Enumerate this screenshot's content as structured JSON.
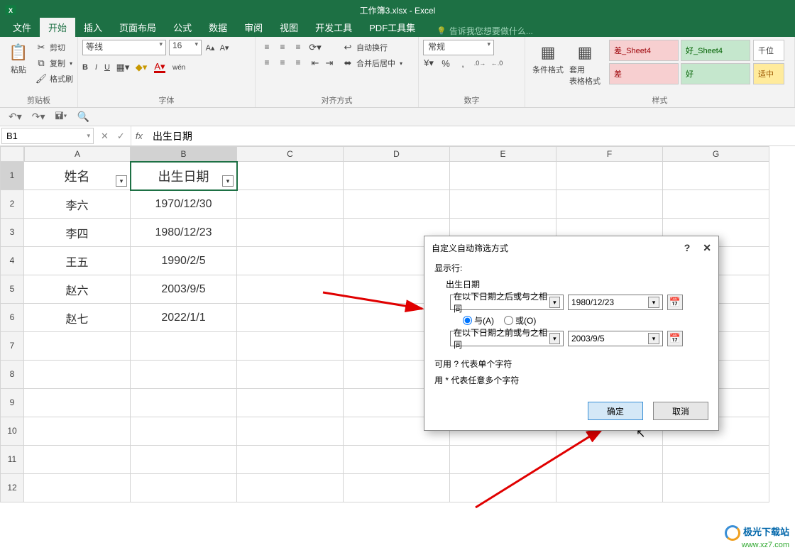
{
  "title": "工作簿3.xlsx - Excel",
  "tabs": [
    "文件",
    "开始",
    "插入",
    "页面布局",
    "公式",
    "数据",
    "审阅",
    "视图",
    "开发工具",
    "PDF工具集"
  ],
  "active_tab": "开始",
  "tell_me": "告诉我您想要做什么...",
  "ribbon": {
    "clipboard": {
      "label": "剪贴板",
      "paste": "粘贴",
      "cut": "剪切",
      "copy": "复制",
      "format_painter": "格式刷"
    },
    "font": {
      "label": "字体",
      "font_name": "等线",
      "font_size": "16",
      "bold": "B",
      "italic": "I",
      "underline": "U",
      "wen": "wén"
    },
    "alignment": {
      "label": "对齐方式",
      "wrap_text": "自动换行",
      "merge_center": "合并后居中"
    },
    "number": {
      "label": "数字",
      "format": "常规"
    },
    "styles": {
      "label": "样式",
      "conditional": "条件格式",
      "table": "套用\n表格格式",
      "cell1": "差_Sheet4",
      "cell2": "好_Sheet4",
      "cell3": "差",
      "cell4": "好",
      "cell5": "千位",
      "cell6": "适中"
    }
  },
  "name_box": "B1",
  "formula": "出生日期",
  "columns": [
    "A",
    "B",
    "C",
    "D",
    "E",
    "F",
    "G"
  ],
  "rows_count": 12,
  "table": {
    "headers": [
      "姓名",
      "出生日期"
    ],
    "data": [
      [
        "李六",
        "1970/12/30"
      ],
      [
        "李四",
        "1980/12/23"
      ],
      [
        "王五",
        "1990/2/5"
      ],
      [
        "赵六",
        "2003/9/5"
      ],
      [
        "赵七",
        "2022/1/1"
      ]
    ]
  },
  "dialog": {
    "title": "自定义自动筛选方式",
    "help": "?",
    "close": "✕",
    "show_rows": "显示行:",
    "column_name": "出生日期",
    "criteria1_op": "在以下日期之后或与之相同",
    "criteria1_val": "1980/12/23",
    "and_label": "与(A)",
    "or_label": "或(O)",
    "criteria2_op": "在以下日期之前或与之相同",
    "criteria2_val": "2003/9/5",
    "hint1": "可用 ? 代表单个字符",
    "hint2": "用 * 代表任意多个字符",
    "ok": "确定",
    "cancel": "取消"
  },
  "watermark": {
    "line1": "极光下载站",
    "line2": "www.xz7.com"
  }
}
